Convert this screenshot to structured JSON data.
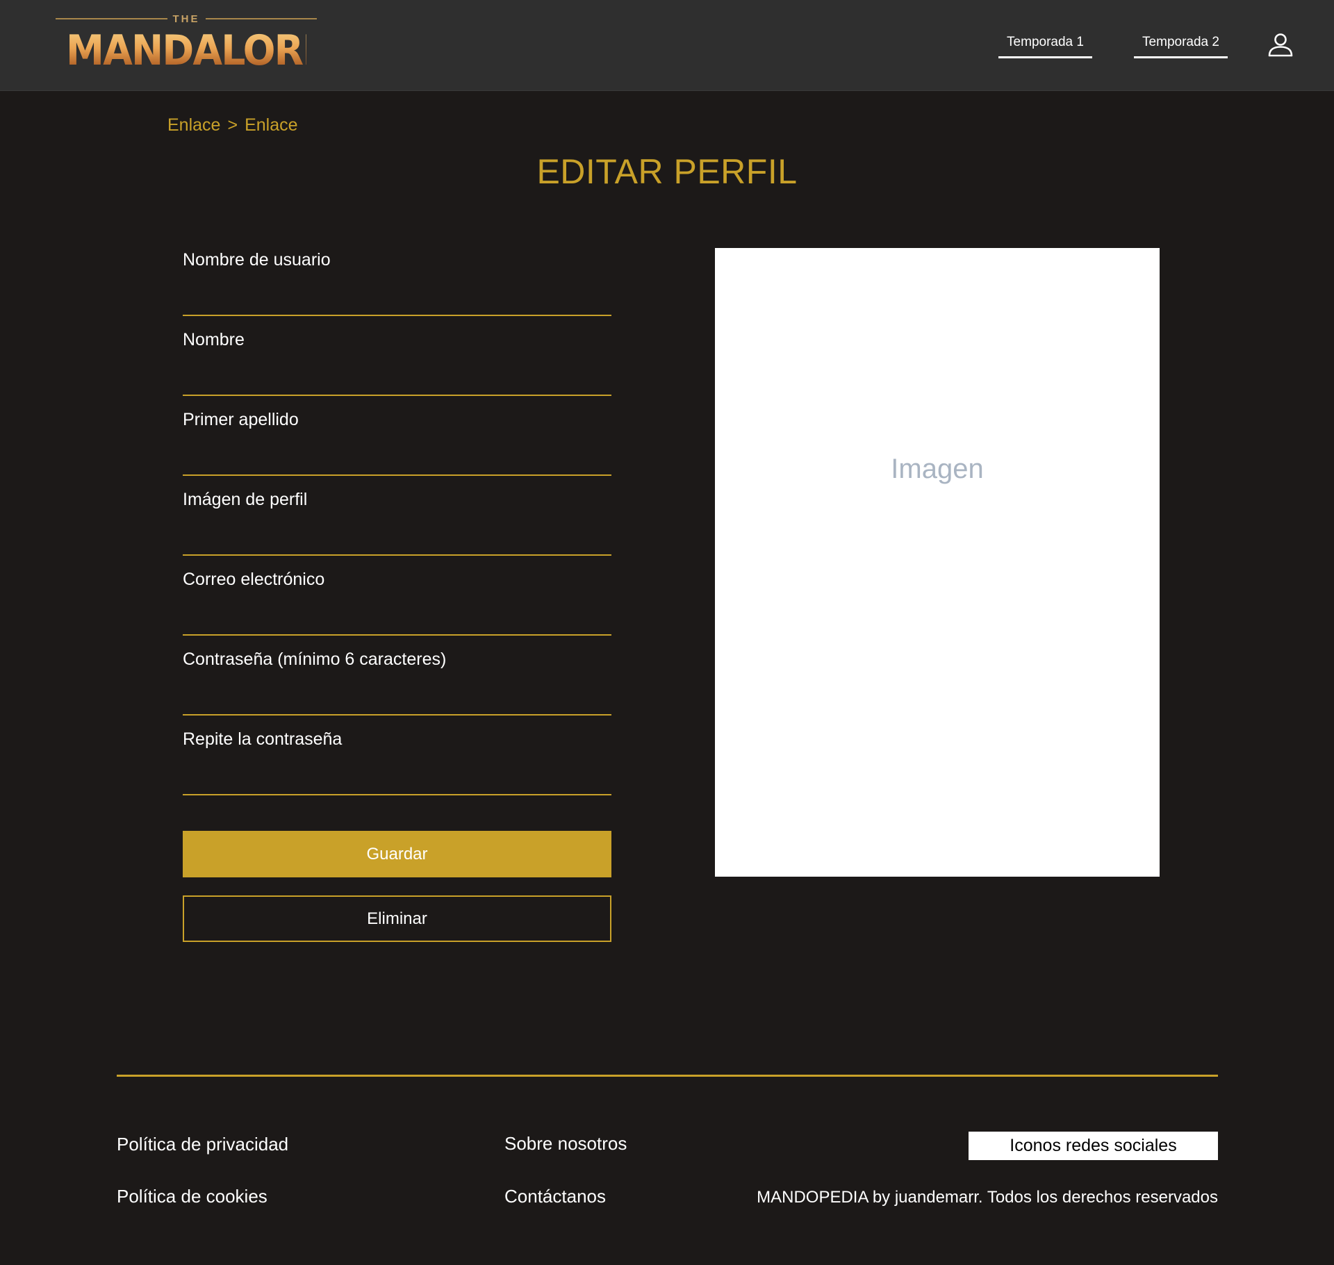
{
  "header": {
    "logo_top": "THE",
    "logo_main": "MANDALORIAN",
    "nav": [
      {
        "label": "Temporada 1"
      },
      {
        "label": "Temporada 2"
      }
    ],
    "user_icon": "user-icon"
  },
  "breadcrumb": {
    "items": [
      "Enlace",
      "Enlace"
    ],
    "separator": ">"
  },
  "page_title": "EDITAR PERFIL",
  "form": {
    "fields": [
      {
        "label": "Nombre de usuario",
        "value": ""
      },
      {
        "label": "Nombre",
        "value": ""
      },
      {
        "label": "Primer apellido",
        "value": ""
      },
      {
        "label": "Imágen de perfil",
        "value": ""
      },
      {
        "label": "Correo electrónico",
        "value": ""
      },
      {
        "label": "Contraseña (mínimo 6 caracteres)",
        "value": ""
      },
      {
        "label": "Repite la contraseña",
        "value": ""
      }
    ],
    "save_label": "Guardar",
    "delete_label": "Eliminar"
  },
  "image_placeholder": "Imagen",
  "footer": {
    "privacy": "Política de privacidad",
    "cookies": "Política de cookies",
    "about": "Sobre nosotros",
    "contact": "Contáctanos",
    "social": "Iconos redes sociales",
    "copyright": "MANDOPEDIA by juandemarr. Todos los derechos reservados"
  },
  "colors": {
    "background": "#1c1918",
    "header": "#2f2f2f",
    "accent": "#c9a129",
    "text": "#ffffff",
    "placeholder_text": "#a9b4c2"
  }
}
